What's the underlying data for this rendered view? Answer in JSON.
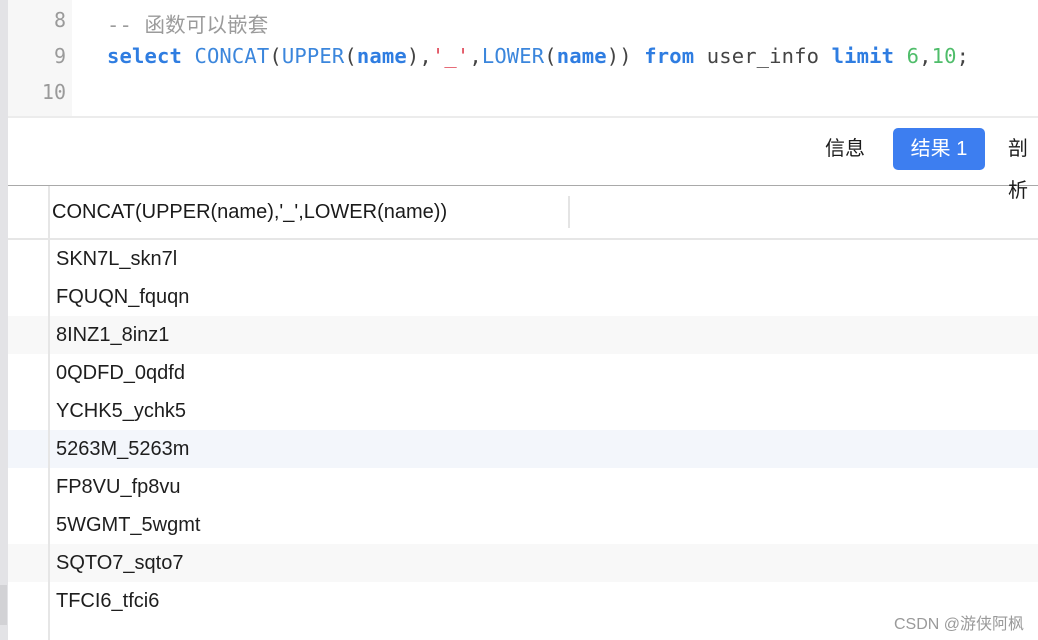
{
  "editor": {
    "lines": [
      {
        "number": "8",
        "comment": "-- 函数可以嵌套"
      },
      {
        "number": "9",
        "tokens": {
          "select": "select",
          "concat": "CONCAT",
          "open1": "(",
          "upper": "UPPER",
          "open2": "(",
          "name1": "name",
          "close2": ")",
          "comma1": ",",
          "str": "'_'",
          "comma2": ",",
          "lower": "LOWER",
          "open3": "(",
          "name2": "name",
          "close3": "))",
          "from": "from",
          "table": "user_info",
          "limit": "limit",
          "offset": "6",
          "comma3": ",",
          "count": "10",
          "semi": ";"
        }
      },
      {
        "number": "10"
      }
    ]
  },
  "tabs": [
    {
      "label": "信息",
      "active": false
    },
    {
      "label": "结果 1",
      "active": true
    },
    {
      "label": "剖析",
      "active": false
    }
  ],
  "colors": {
    "accent": "#3d7ef0",
    "keyword": "#2f7de1",
    "string": "#e04b5a",
    "number": "#4fbd6a"
  },
  "results": {
    "columns": [
      "CONCAT(UPPER(name),'_',LOWER(name))"
    ],
    "rows": [
      "SKN7L_skn7l",
      "FQUQN_fquqn",
      "8INZ1_8inz1",
      "0QDFD_0qdfd",
      "YCHK5_ychk5",
      "5263M_5263m",
      "FP8VU_fp8vu",
      "5WGMT_5wgmt",
      "SQTO7_sqto7",
      "TFCI6_tfci6"
    ]
  },
  "watermark": "CSDN @游侠阿枫"
}
